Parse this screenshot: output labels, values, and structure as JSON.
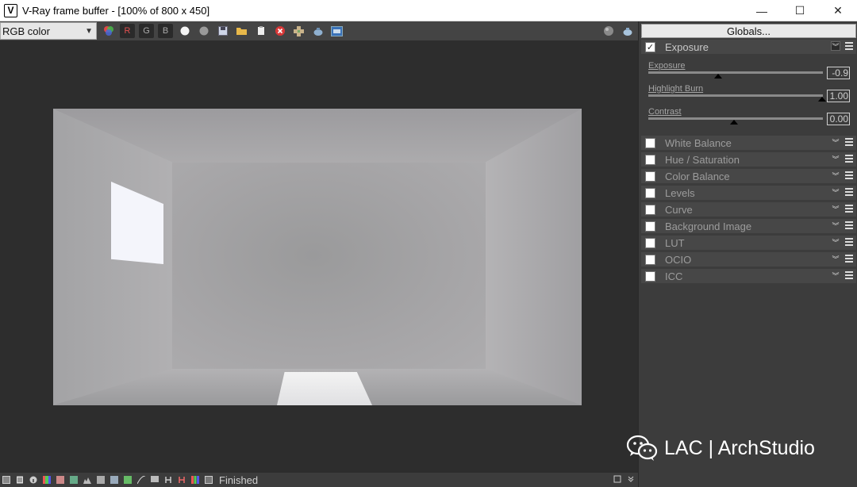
{
  "window": {
    "title": "V-Ray frame buffer - [100% of 800 x 450]",
    "icon": "vray-logo-icon",
    "controls": [
      "minimize-icon",
      "maximize-icon",
      "close-icon"
    ],
    "minimize_glyph": "—",
    "maximize_glyph": "☐",
    "close_glyph": "✕"
  },
  "toolbar": {
    "channel": "RGB color",
    "channel_letters": {
      "r": "R",
      "g": "G",
      "b": "B"
    },
    "red_color": "#e05050",
    "green_color": "#aaaaaa",
    "blue_color": "#aaaaaa"
  },
  "panel": {
    "globals_label": "Globals...",
    "exposure": {
      "label": "Exposure",
      "checked": true,
      "sliders": [
        {
          "label": "Exposure",
          "value": "-0.9",
          "position": 0.4
        },
        {
          "label": "Highlight Burn",
          "value": "1.00",
          "position": 1.0
        },
        {
          "label": "Contrast",
          "value": "0.00",
          "position": 0.5
        }
      ]
    },
    "sections": [
      {
        "label": "White Balance",
        "checked": false
      },
      {
        "label": "Hue / Saturation",
        "checked": false
      },
      {
        "label": "Color Balance",
        "checked": false
      },
      {
        "label": "Levels",
        "checked": false
      },
      {
        "label": "Curve",
        "checked": false
      },
      {
        "label": "Background Image",
        "checked": false
      },
      {
        "label": "LUT",
        "checked": false
      },
      {
        "label": "OCIO",
        "checked": false
      },
      {
        "label": "ICC",
        "checked": false
      }
    ]
  },
  "status": {
    "text": "Finished"
  },
  "watermark": {
    "text": "LAC | ArchStudio"
  }
}
